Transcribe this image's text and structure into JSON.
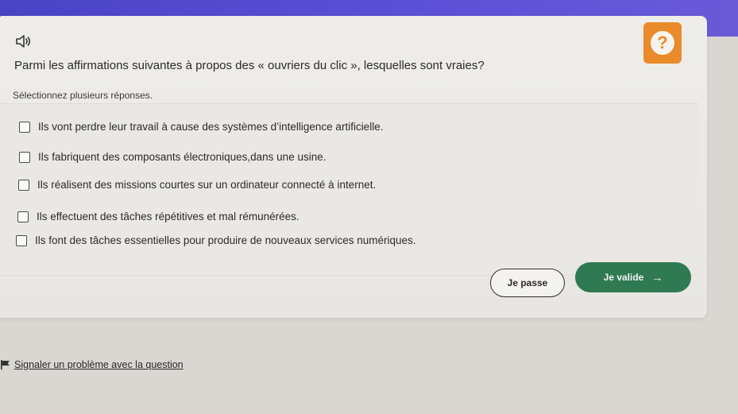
{
  "question": {
    "text": "Parmi les affirmations suivantes à propos des « ouvriers du clic », lesquelles sont vraies?",
    "instruction": "Sélectionnez plusieurs réponses."
  },
  "help": {
    "symbol": "?"
  },
  "icons": {
    "audio": "speaker-icon",
    "help": "help-icon",
    "flag": "flag-icon",
    "arrow": "arrow-right-icon"
  },
  "options": [
    {
      "label": "Ils vont perdre leur travail à cause des systèmes d’intelligence artificielle.",
      "checked": false
    },
    {
      "label": "Ils fabriquent des composants électroniques,dans une usine.",
      "checked": false
    },
    {
      "label": "Ils réalisent des missions courtes sur un ordinateur connecté à internet.",
      "checked": false
    },
    {
      "label": "Ils effectuent des tâches répétitives et mal rémunérées.",
      "checked": false
    },
    {
      "label": "Ils font des tâches essentielles pour produire de nouveaux services numériques.",
      "checked": false
    }
  ],
  "actions": {
    "skip_label": "Je passe",
    "validate_label": "Je valide",
    "validate_arrow": "→"
  },
  "footer": {
    "report_label": "Signaler un problème avec la question"
  },
  "colors": {
    "header": "#5b4fd6",
    "help_badge": "#e98b2a",
    "validate": "#2f7a53"
  }
}
